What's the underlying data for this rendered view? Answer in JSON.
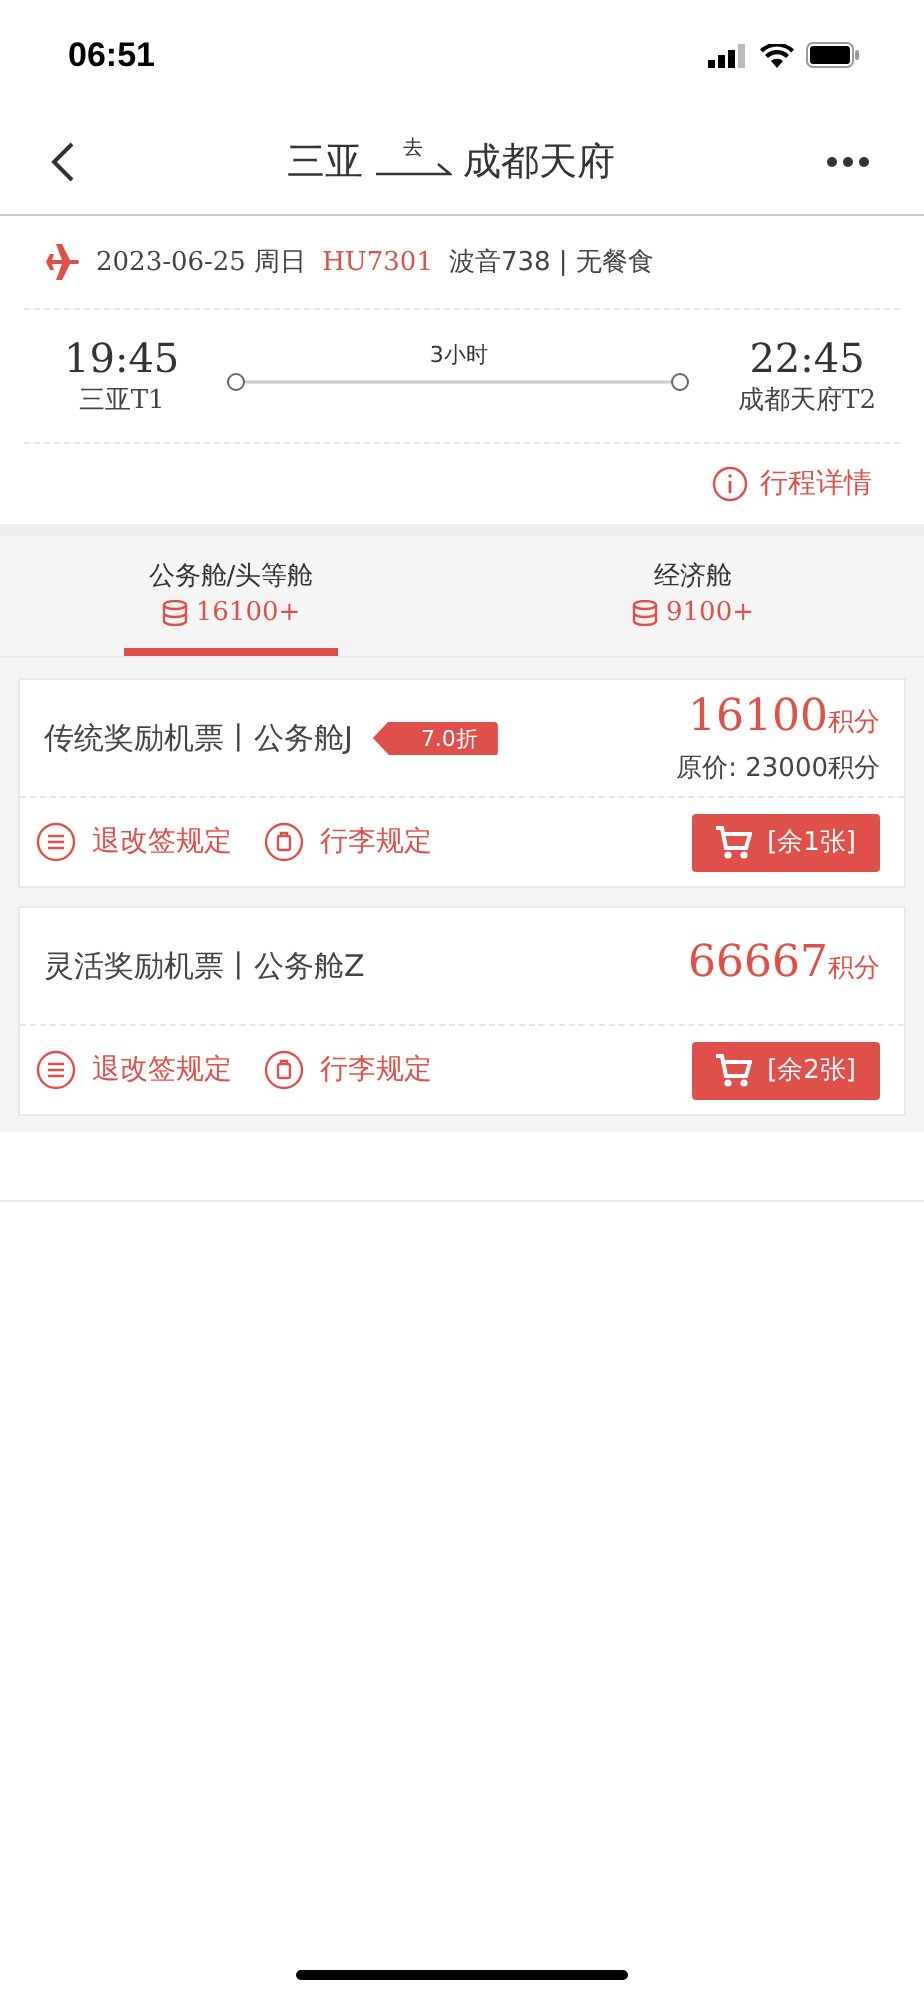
{
  "status_bar": {
    "time": "06:51"
  },
  "nav": {
    "origin": "三亚",
    "direction": "去",
    "destination": "成都天府"
  },
  "flight": {
    "date": "2023-06-25 周日",
    "number": "HU7301",
    "aircraft": "波音738 | 无餐食",
    "depart_time": "19:45",
    "depart_airport": "三亚T1",
    "duration": "3小时",
    "arrive_time": "22:45",
    "arrive_airport": "成都天府T2",
    "details_link": "行程详情"
  },
  "tabs": [
    {
      "label": "公务舱/头等舱",
      "price": "16100+",
      "selected": true
    },
    {
      "label": "经济舱",
      "price": "9100+",
      "selected": false
    }
  ],
  "fares": [
    {
      "name": "传统奖励机票丨公务舱J",
      "discount": "7.0折",
      "points": "16100",
      "unit": "积分",
      "original": "原价: 23000积分",
      "refund_rule": "退改签规定",
      "baggage_rule": "行李规定",
      "book": "[余1张]"
    },
    {
      "name": "灵活奖励机票丨公务舱Z",
      "points": "66667",
      "unit": "积分",
      "refund_rule": "退改签规定",
      "baggage_rule": "行李规定",
      "book": "[余2张]"
    }
  ]
}
